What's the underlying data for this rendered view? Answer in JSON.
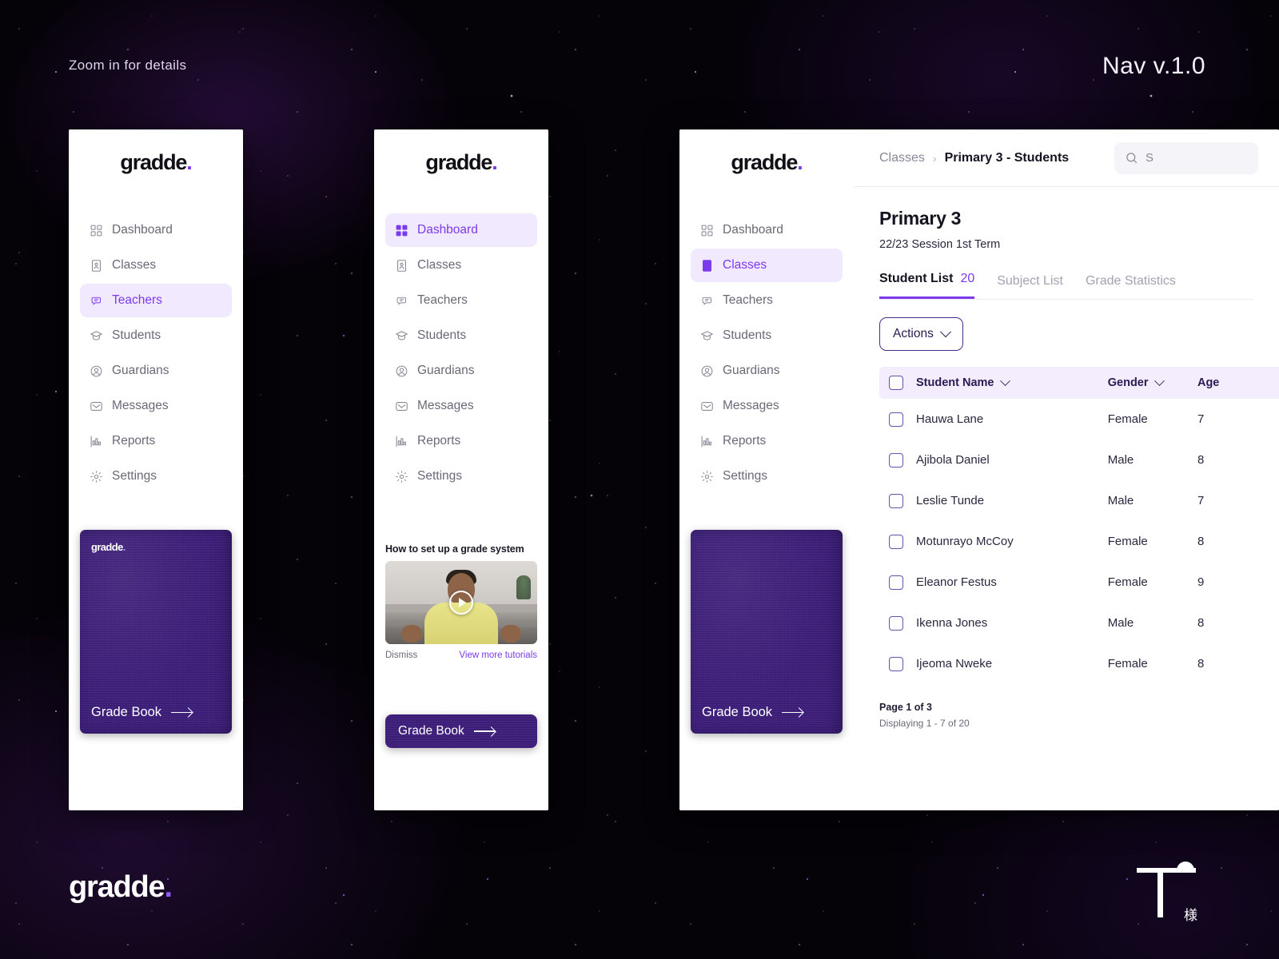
{
  "canvas": {
    "hint": "Zoom in for details",
    "version": "Nav v.1.0",
    "footer_logo": "gradde",
    "footer_logo_dot": ".",
    "watermark_cjk": "様",
    "accent": "#7c3aed",
    "accent_soft": "#f1e9fe",
    "book_purple": "#3d1e7a",
    "background": "#050208"
  },
  "brand": {
    "name": "gradde",
    "dot": "."
  },
  "nav": {
    "items": [
      {
        "label": "Dashboard",
        "icon": "grid-icon"
      },
      {
        "label": "Classes",
        "icon": "id-card-icon"
      },
      {
        "label": "Teachers",
        "icon": "teacher-chat-icon"
      },
      {
        "label": "Students",
        "icon": "graduation-cap-icon"
      },
      {
        "label": "Guardians",
        "icon": "user-circle-icon"
      },
      {
        "label": "Messages",
        "icon": "envelope-icon"
      },
      {
        "label": "Reports",
        "icon": "bar-chart-icon"
      },
      {
        "label": "Settings",
        "icon": "gear-icon"
      }
    ],
    "active_panel1": "Teachers",
    "active_panel2": "Dashboard",
    "active_panel3": "Classes"
  },
  "gradebook_card": {
    "brand": "gradde",
    "dot": ".",
    "cta": "Grade Book"
  },
  "gradebook_button": {
    "label": "Grade Book"
  },
  "tutorial": {
    "title": "How to set up a grade system",
    "dismiss": "Dismiss",
    "more": "View more tutorials",
    "play_icon": "play-icon"
  },
  "topbar": {
    "breadcrumb_root": "Classes",
    "breadcrumb_sep": "›",
    "breadcrumb_current": "Primary 3 - Students",
    "search_placeholder": "S",
    "search_icon": "search-icon"
  },
  "page": {
    "title": "Primary 3",
    "subtitle": "22/23 Session  1st Term",
    "tabs": [
      {
        "label": "Student List",
        "count": "20",
        "active": true
      },
      {
        "label": "Subject List",
        "count": "",
        "active": false
      },
      {
        "label": "Grade Statistics",
        "count": "",
        "active": false
      }
    ],
    "actions_label": "Actions"
  },
  "table": {
    "columns": [
      "Student Name",
      "Gender",
      "Age"
    ],
    "rows": [
      {
        "name": "Hauwa Lane",
        "gender": "Female",
        "age": "7"
      },
      {
        "name": "Ajibola Daniel",
        "gender": "Male",
        "age": "8"
      },
      {
        "name": "Leslie Tunde",
        "gender": "Male",
        "age": "7"
      },
      {
        "name": "Motunrayo McCoy",
        "gender": "Female",
        "age": "8"
      },
      {
        "name": "Eleanor Festus",
        "gender": "Female",
        "age": "9"
      },
      {
        "name": "Ikenna Jones",
        "gender": "Male",
        "age": "8"
      },
      {
        "name": "Ijeoma Nweke",
        "gender": "Female",
        "age": "8"
      }
    ]
  },
  "pagination": {
    "page_label": "Page 1 of 3",
    "displaying": "Displaying 1 - 7 of 20"
  }
}
